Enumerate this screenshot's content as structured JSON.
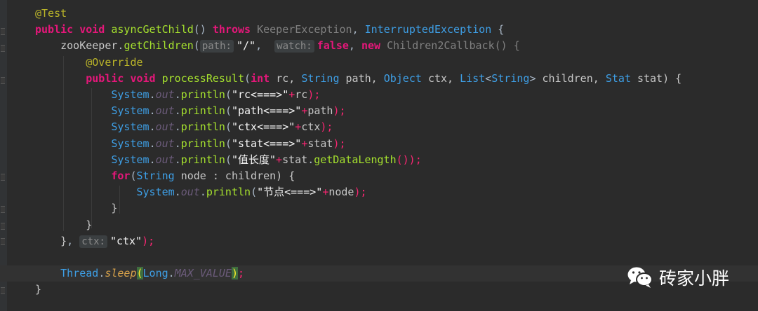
{
  "editor": {
    "lines": [
      {
        "tokens": [
          {
            "t": "@Test",
            "c": "ann"
          }
        ]
      },
      {
        "tokens": [
          {
            "t": "public ",
            "c": "kw2"
          },
          {
            "t": "void ",
            "c": "kw2"
          },
          {
            "t": "asyncGetChild",
            "c": "method"
          },
          {
            "t": "() ",
            "c": "plain"
          },
          {
            "t": "throws ",
            "c": "kw2"
          },
          {
            "t": "KeeperException",
            "c": "gray"
          },
          {
            "t": ", ",
            "c": "plain"
          },
          {
            "t": "InterruptedException",
            "c": "type"
          },
          {
            "t": " {",
            "c": "plain"
          }
        ]
      },
      {
        "tokens": [
          {
            "t": "    zooKeeper",
            "c": "var"
          },
          {
            "t": ".",
            "c": "plain"
          },
          {
            "t": "getChildren",
            "c": "method"
          },
          {
            "t": "(",
            "c": "plain"
          },
          {
            "t": "path:",
            "c": "hint"
          },
          {
            "t": "\"/\"",
            "c": "str"
          },
          {
            "t": ",  ",
            "c": "plain"
          },
          {
            "t": "watch:",
            "c": "hint"
          },
          {
            "t": "false",
            "c": "kw2"
          },
          {
            "t": ", ",
            "c": "plain"
          },
          {
            "t": "new ",
            "c": "kw2"
          },
          {
            "t": "Children2Callback",
            "c": "gray"
          },
          {
            "t": "() {",
            "c": "gray"
          }
        ]
      },
      {
        "tokens": [
          {
            "t": "        @Override",
            "c": "ann"
          }
        ]
      },
      {
        "tokens": [
          {
            "t": "        public ",
            "c": "kw2"
          },
          {
            "t": "void ",
            "c": "kw2"
          },
          {
            "t": "processResult",
            "c": "method"
          },
          {
            "t": "(",
            "c": "plain"
          },
          {
            "t": "int ",
            "c": "kw2"
          },
          {
            "t": "rc, ",
            "c": "var"
          },
          {
            "t": "String ",
            "c": "type"
          },
          {
            "t": "path, ",
            "c": "var"
          },
          {
            "t": "Object ",
            "c": "type"
          },
          {
            "t": "ctx, ",
            "c": "var"
          },
          {
            "t": "List",
            "c": "type"
          },
          {
            "t": "<",
            "c": "plain"
          },
          {
            "t": "String",
            "c": "type"
          },
          {
            "t": "> ",
            "c": "plain"
          },
          {
            "t": "children, ",
            "c": "var"
          },
          {
            "t": "Stat ",
            "c": "type"
          },
          {
            "t": "stat) {",
            "c": "var"
          }
        ]
      },
      {
        "tokens": [
          {
            "t": "            System",
            "c": "type"
          },
          {
            "t": ".",
            "c": "plain"
          },
          {
            "t": "out",
            "c": "field-i"
          },
          {
            "t": ".",
            "c": "plain"
          },
          {
            "t": "println",
            "c": "method"
          },
          {
            "t": "(",
            "c": "plain"
          },
          {
            "t": "\"rc<===>\"",
            "c": "str"
          },
          {
            "t": "+",
            "c": "pink"
          },
          {
            "t": "rc",
            "c": "var"
          },
          {
            "t": ");",
            "c": "pink"
          }
        ]
      },
      {
        "tokens": [
          {
            "t": "            System",
            "c": "type"
          },
          {
            "t": ".",
            "c": "plain"
          },
          {
            "t": "out",
            "c": "field-i"
          },
          {
            "t": ".",
            "c": "plain"
          },
          {
            "t": "println",
            "c": "method"
          },
          {
            "t": "(",
            "c": "plain"
          },
          {
            "t": "\"path<===>\"",
            "c": "str"
          },
          {
            "t": "+",
            "c": "pink"
          },
          {
            "t": "path",
            "c": "var"
          },
          {
            "t": ");",
            "c": "pink"
          }
        ]
      },
      {
        "tokens": [
          {
            "t": "            System",
            "c": "type"
          },
          {
            "t": ".",
            "c": "plain"
          },
          {
            "t": "out",
            "c": "field-i"
          },
          {
            "t": ".",
            "c": "plain"
          },
          {
            "t": "println",
            "c": "method"
          },
          {
            "t": "(",
            "c": "plain"
          },
          {
            "t": "\"ctx<===>\"",
            "c": "str"
          },
          {
            "t": "+",
            "c": "pink"
          },
          {
            "t": "ctx",
            "c": "var"
          },
          {
            "t": ");",
            "c": "pink"
          }
        ]
      },
      {
        "tokens": [
          {
            "t": "            System",
            "c": "type"
          },
          {
            "t": ".",
            "c": "plain"
          },
          {
            "t": "out",
            "c": "field-i"
          },
          {
            "t": ".",
            "c": "plain"
          },
          {
            "t": "println",
            "c": "method"
          },
          {
            "t": "(",
            "c": "plain"
          },
          {
            "t": "\"stat<===>\"",
            "c": "str"
          },
          {
            "t": "+",
            "c": "pink"
          },
          {
            "t": "stat",
            "c": "var"
          },
          {
            "t": ");",
            "c": "pink"
          }
        ]
      },
      {
        "tokens": [
          {
            "t": "            System",
            "c": "type"
          },
          {
            "t": ".",
            "c": "plain"
          },
          {
            "t": "out",
            "c": "field-i"
          },
          {
            "t": ".",
            "c": "plain"
          },
          {
            "t": "println",
            "c": "method"
          },
          {
            "t": "(",
            "c": "plain"
          },
          {
            "t": "\"值长度\"",
            "c": "str"
          },
          {
            "t": "+",
            "c": "pink"
          },
          {
            "t": "stat",
            "c": "var"
          },
          {
            "t": ".",
            "c": "plain"
          },
          {
            "t": "getDataLength",
            "c": "method"
          },
          {
            "t": "());",
            "c": "pink"
          }
        ]
      },
      {
        "tokens": [
          {
            "t": "            for",
            "c": "kw2"
          },
          {
            "t": "(",
            "c": "plain"
          },
          {
            "t": "String ",
            "c": "type"
          },
          {
            "t": "node : children) {",
            "c": "var"
          }
        ]
      },
      {
        "tokens": [
          {
            "t": "                System",
            "c": "type"
          },
          {
            "t": ".",
            "c": "plain"
          },
          {
            "t": "out",
            "c": "field-i"
          },
          {
            "t": ".",
            "c": "plain"
          },
          {
            "t": "println",
            "c": "method"
          },
          {
            "t": "(",
            "c": "plain"
          },
          {
            "t": "\"节点<===>\"",
            "c": "str"
          },
          {
            "t": "+",
            "c": "pink"
          },
          {
            "t": "node",
            "c": "var"
          },
          {
            "t": ");",
            "c": "pink"
          }
        ]
      },
      {
        "tokens": [
          {
            "t": "            }",
            "c": "var"
          }
        ]
      },
      {
        "tokens": [
          {
            "t": "        }",
            "c": "var"
          }
        ]
      },
      {
        "tokens": [
          {
            "t": "    }",
            "c": "var"
          },
          {
            "t": ", ",
            "c": "plain"
          },
          {
            "t": "ctx:",
            "c": "hint"
          },
          {
            "t": "\"ctx\"",
            "c": "str"
          },
          {
            "t": ");",
            "c": "pink"
          }
        ]
      },
      {
        "tokens": []
      },
      {
        "tokens": [
          {
            "t": "    Thread",
            "c": "type"
          },
          {
            "t": ".",
            "c": "plain"
          },
          {
            "t": "sleep",
            "c": "static-m"
          },
          {
            "t": "(",
            "c": "brace"
          },
          {
            "t": "Long",
            "c": "type"
          },
          {
            "t": ".",
            "c": "plain"
          },
          {
            "t": "MAX_VALUE",
            "c": "field-i"
          },
          {
            "t": ")",
            "c": "brace"
          },
          {
            "t": ";",
            "c": "pink"
          }
        ]
      },
      {
        "tokens": [
          {
            "t": "}",
            "c": "var"
          }
        ]
      }
    ]
  },
  "watermark": {
    "text": "砖家小胖",
    "icon": "wechat-icon"
  }
}
